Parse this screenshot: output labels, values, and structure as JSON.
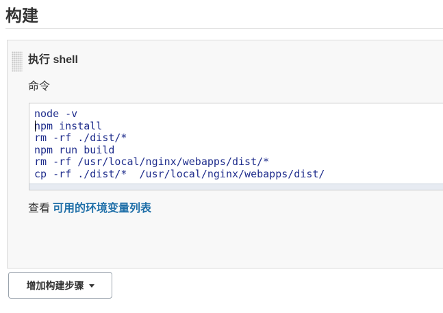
{
  "section": {
    "title": "构建"
  },
  "step": {
    "title": "执行 shell",
    "command_label": "命令",
    "command_lines": [
      "node -v",
      "npm install",
      "rm -rf ./dist/*",
      "npm run build",
      "rm -rf /usr/local/nginx/webapps/dist/*",
      "cp -rf ./dist/*  /usr/local/nginx/webapps/dist/"
    ],
    "env_prefix": "查看",
    "env_link": "可用的环境变量列表"
  },
  "add_step_button": {
    "label": "增加构建步骤"
  },
  "colors": {
    "code_text": "#1f2d8c",
    "link": "#1f6fa8",
    "panel_bg": "#f8f8f8"
  }
}
